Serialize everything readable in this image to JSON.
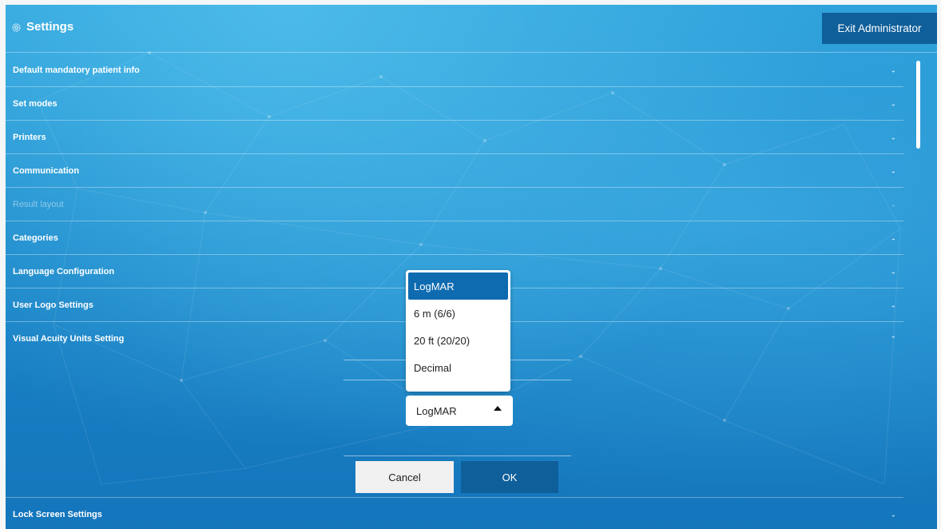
{
  "header": {
    "title": "Settings",
    "exit_label": "Exit Administrator"
  },
  "sections": [
    {
      "label": "Default mandatory patient info",
      "state": "collapsed"
    },
    {
      "label": "Set modes",
      "state": "collapsed"
    },
    {
      "label": "Printers",
      "state": "collapsed"
    },
    {
      "label": "Communication",
      "state": "collapsed"
    },
    {
      "label": "Result layout",
      "state": "disabled"
    },
    {
      "label": "Categories",
      "state": "collapsed"
    },
    {
      "label": "Language Configuration",
      "state": "collapsed"
    },
    {
      "label": "User Logo Settings",
      "state": "collapsed"
    },
    {
      "label": "Visual Acuity Units Setting",
      "state": "expanded"
    },
    {
      "label": "Lock Screen Settings",
      "state": "collapsed"
    }
  ],
  "acuity": {
    "selected": "LogMAR",
    "options": [
      "LogMAR",
      "6 m (6/6)",
      "20 ft (20/20)",
      "Decimal"
    ],
    "cancel_label": "Cancel",
    "ok_label": "OK"
  },
  "icons": {
    "chevron_down": "⌄",
    "chevron_up": "⌃"
  },
  "colors": {
    "accent": "#0f5f9a",
    "selected_option": "#0e6bb0"
  }
}
